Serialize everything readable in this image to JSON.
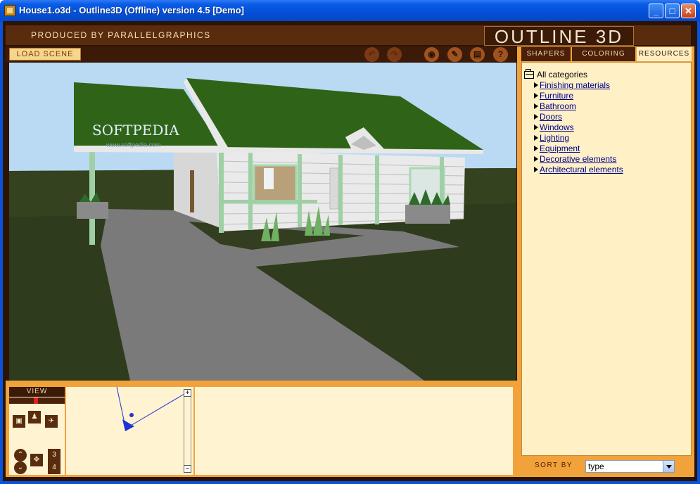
{
  "window": {
    "title": "House1.o3d - Outline3D (Offline) version 4.5 [Demo]",
    "controls": {
      "minimize": "_",
      "maximize": "□",
      "close": "✕"
    }
  },
  "header": {
    "produced_by": "PRODUCED BY PARALLELGRAPHICS",
    "brand": "OUTLINE 3D"
  },
  "toolbar": {
    "load_scene": "LOAD SCENE",
    "tools": [
      {
        "icon": "undo-icon",
        "glyph": "↶"
      },
      {
        "icon": "redo-icon",
        "glyph": "↷"
      },
      {
        "icon": "camera-icon",
        "glyph": "◉"
      },
      {
        "icon": "paint-icon",
        "glyph": "✎"
      },
      {
        "icon": "notes-icon",
        "glyph": "▤"
      },
      {
        "icon": "help-icon",
        "glyph": "?"
      }
    ]
  },
  "tabs": [
    {
      "label": "SHAPERS",
      "active": false
    },
    {
      "label": "COLORING",
      "active": false
    },
    {
      "label": "RESOURCES",
      "active": true
    }
  ],
  "resources": {
    "root": "All categories",
    "items": [
      "Finishing materials",
      "Furniture",
      "Bathroom",
      "Doors",
      "Windows",
      "Lighting",
      "Equipment",
      "Decorative elements",
      "Architectural elements"
    ]
  },
  "sort": {
    "label": "SORT BY",
    "value": "type"
  },
  "watermark": {
    "text": "SOFTPEDIA",
    "sub": "www.softpedia.com"
  },
  "view_panel": {
    "title": "VIEW",
    "zoom_in": "+",
    "zoom_out": "−",
    "view_numbers": [
      "3",
      "4"
    ]
  },
  "colors": {
    "title_bar": "#0a5ce6",
    "frame": "#f2a23a",
    "panel": "#fff0c6",
    "dark_brown": "#3b1a07",
    "sky": "#b9d8f2",
    "grass": "#2e3b1c",
    "roof": "#2f6418"
  }
}
